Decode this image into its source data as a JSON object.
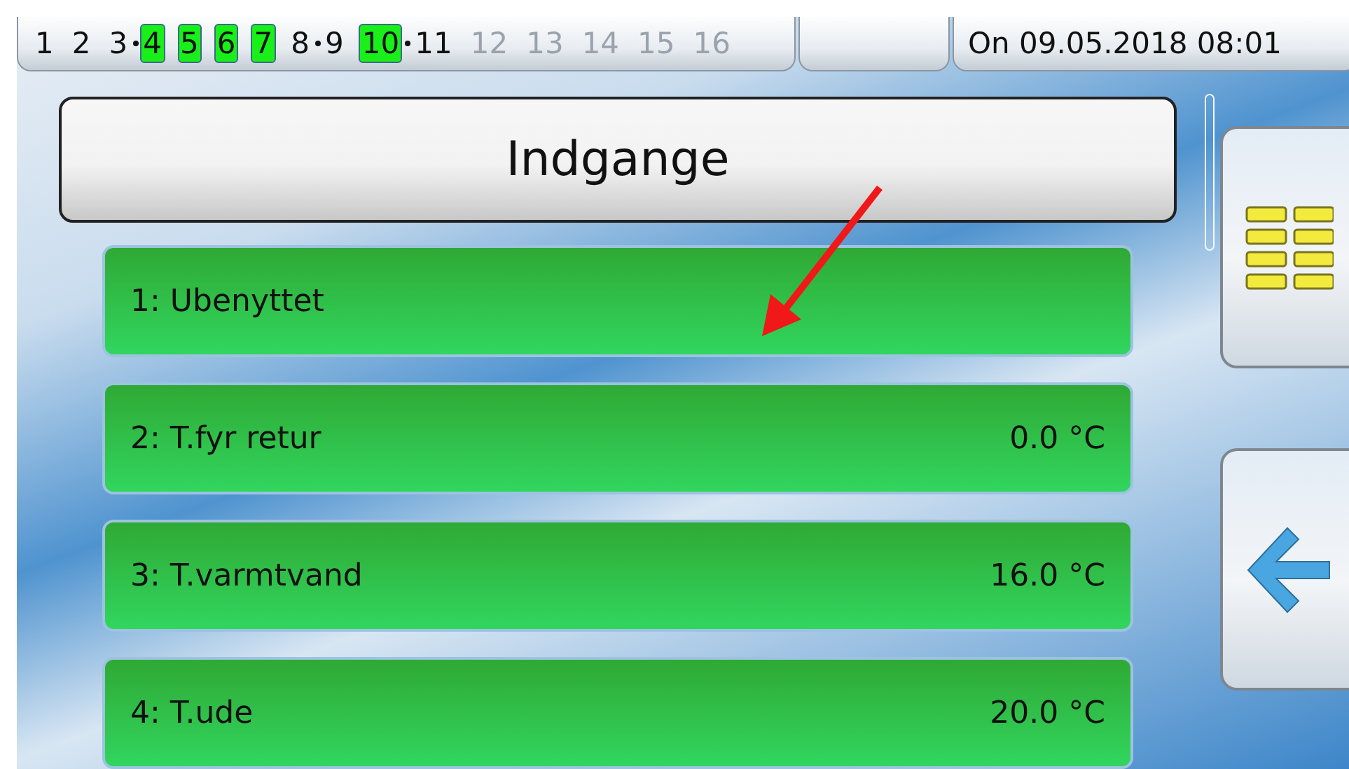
{
  "status_bar": {
    "channels": [
      {
        "label": "1",
        "active": false,
        "disabled": false,
        "linked": false
      },
      {
        "label": "2",
        "active": false,
        "disabled": false,
        "linked": false
      },
      {
        "label": "3",
        "active": false,
        "disabled": false,
        "linked": true
      },
      {
        "label": "4",
        "active": true,
        "disabled": false,
        "linked": false
      },
      {
        "label": "5",
        "active": true,
        "disabled": false,
        "linked": false
      },
      {
        "label": "6",
        "active": true,
        "disabled": false,
        "linked": false
      },
      {
        "label": "7",
        "active": true,
        "disabled": false,
        "linked": false
      },
      {
        "label": "8",
        "active": false,
        "disabled": false,
        "linked": true
      },
      {
        "label": "9",
        "active": false,
        "disabled": false,
        "linked": false
      },
      {
        "label": "10",
        "active": true,
        "disabled": false,
        "linked": true
      },
      {
        "label": "11",
        "active": false,
        "disabled": false,
        "linked": false
      },
      {
        "label": "12",
        "active": false,
        "disabled": true,
        "linked": false
      },
      {
        "label": "13",
        "active": false,
        "disabled": true,
        "linked": false
      },
      {
        "label": "14",
        "active": false,
        "disabled": true,
        "linked": false
      },
      {
        "label": "15",
        "active": false,
        "disabled": true,
        "linked": false
      },
      {
        "label": "16",
        "active": false,
        "disabled": true
      }
    ],
    "datetime": "On 09.05.2018 08:01"
  },
  "title": "Indgange",
  "inputs": [
    {
      "name": "1: Ubenyttet"
    },
    {
      "name": "2: T.fyr retur",
      "value": "0.0 °C"
    },
    {
      "name": "3: T.varmtvand",
      "value": "16.0 °C"
    },
    {
      "name": "4: T.ude",
      "value": "20.0 °C"
    }
  ],
  "side_buttons": [
    {
      "kind": "menu"
    },
    {
      "kind": "back"
    }
  ]
}
